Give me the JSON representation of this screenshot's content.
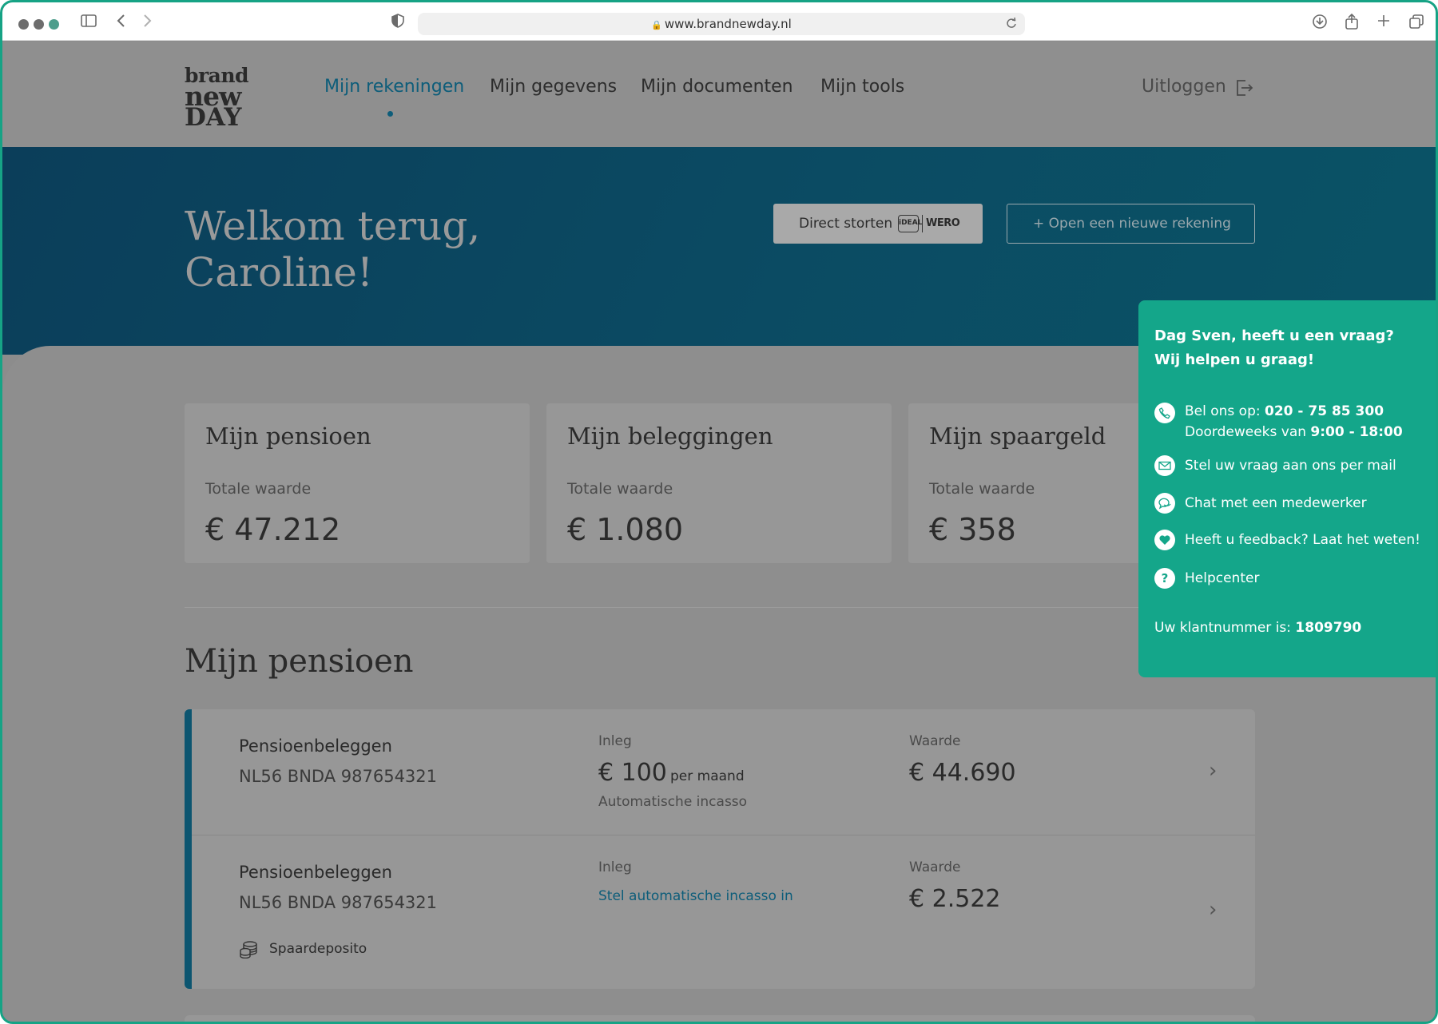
{
  "browser": {
    "url": "www.brandnewday.nl"
  },
  "logo": {
    "line1": "brand",
    "line2": "new",
    "line3": "DAY"
  },
  "nav": {
    "items": [
      "Mijn rekeningen",
      "Mijn gegevens",
      "Mijn documenten",
      "Mijn tools"
    ],
    "active": "Mijn rekeningen",
    "logout": "Uitloggen"
  },
  "hero": {
    "greeting_line1": "Welkom terug,",
    "greeting_line2": "Caroline!",
    "deposit_button": "Direct storten",
    "ideal_label": "iDEAL",
    "wero_label": "WERO",
    "open_button": "+ Open een nieuwe rekening"
  },
  "cards": [
    {
      "title": "Mijn pensioen",
      "label": "Totale waarde",
      "value": "€ 47.212"
    },
    {
      "title": "Mijn beleggingen",
      "label": "Totale waarde",
      "value": "€ 1.080"
    },
    {
      "title": "Mijn spaargeld",
      "label": "Totale waarde",
      "value": "€ 358"
    }
  ],
  "pension_section": {
    "title": "Mijn pensioen",
    "accounts": [
      {
        "name": "Pensioenbeleggen",
        "iban": "NL56 BNDA 987654321",
        "inleg_label": "Inleg",
        "inleg_amount": "€ 100",
        "inleg_period": "per maand",
        "inleg_note": "Automatische incasso",
        "waarde_label": "Waarde",
        "waarde": "€ 44.690"
      },
      {
        "name": "Pensioenbeleggen",
        "iban": "NL56 BNDA 987654321",
        "inleg_label": "Inleg",
        "inleg_link": "Stel automatische incasso in",
        "waarde_label": "Waarde",
        "waarde": "€ 2.522",
        "tag": "Spaardeposito"
      }
    ]
  },
  "help_panel": {
    "title_line1": "Dag Sven, heeft u een vraag?",
    "title_line2": "Wij helpen u graag!",
    "call_prefix": "Bel ons op: ",
    "call_number": "020 - 75 85 300",
    "hours_prefix": "Doordeweeks van ",
    "hours": "9:00 - 18:00",
    "mail": "Stel uw vraag aan ons per mail",
    "chat": "Chat met een medewerker",
    "feedback": "Heeft u feedback? Laat het weten!",
    "helpcenter": "Helpcenter",
    "customer_prefix": "Uw klantnummer is: ",
    "customer_number": "1809790"
  }
}
